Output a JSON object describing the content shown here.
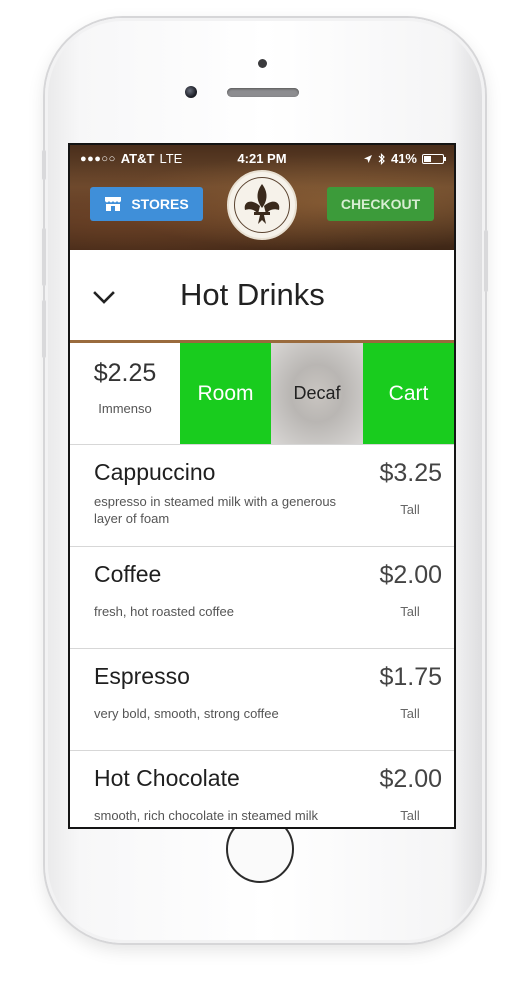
{
  "status_bar": {
    "signal": "●●●○○",
    "carrier": "AT&T",
    "network": "LTE",
    "time": "4:21 PM",
    "battery_text": "41%",
    "battery_level": 0.41
  },
  "header": {
    "stores_label": "STORES",
    "checkout_label": "CHECKOUT",
    "logo_icon": "coffee-company-seal"
  },
  "title_bar": {
    "title": "Hot Drinks"
  },
  "selected_item": {
    "price": "$2.25",
    "size": "Immenso",
    "actions": [
      "Room",
      "Decaf",
      "Cart"
    ]
  },
  "menu_items": [
    {
      "name": "Cappuccino",
      "description": "espresso in steamed milk with a generous layer of foam",
      "price": "$3.25",
      "size": "Tall"
    },
    {
      "name": "Coffee",
      "description": "fresh, hot roasted coffee",
      "price": "$2.00",
      "size": "Tall"
    },
    {
      "name": "Espresso",
      "description": "very bold, smooth, strong coffee",
      "price": "$1.75",
      "size": "Tall"
    },
    {
      "name": "Hot Chocolate",
      "description": "smooth, rich chocolate in steamed milk",
      "price": "$2.00",
      "size": "Tall"
    }
  ],
  "colors": {
    "stores_button": "#3f8fd9",
    "checkout_button": "#3c9b3a",
    "action_green": "#19cc1e"
  }
}
